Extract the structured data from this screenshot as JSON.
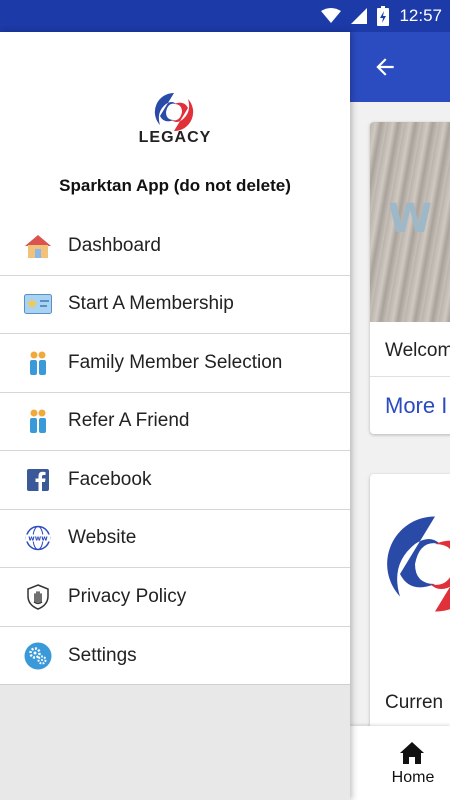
{
  "status_bar": {
    "time": "12:57",
    "bg_color": "#1c3aa8"
  },
  "app_bar": {
    "back_icon": "arrow-left-icon",
    "bg_color": "#2b4bc1"
  },
  "background_cards": [
    {
      "title": "Welcom",
      "link": "More I",
      "image_text": "W"
    },
    {
      "title": "Curren"
    }
  ],
  "bottom_nav": {
    "home_label": "Home",
    "home_icon": "home-icon"
  },
  "drawer": {
    "brand": "LEGACY",
    "app_name": "Sparktan App (do not delete)",
    "items": [
      {
        "label": "Dashboard",
        "icon": "house-icon"
      },
      {
        "label": "Start A Membership",
        "icon": "membership-card-icon"
      },
      {
        "label": "Family Member Selection",
        "icon": "people-icon"
      },
      {
        "label": "Refer A Friend",
        "icon": "people-icon"
      },
      {
        "label": "Facebook",
        "icon": "facebook-icon"
      },
      {
        "label": "Website",
        "icon": "www-globe-icon"
      },
      {
        "label": "Privacy Policy",
        "icon": "shield-hand-icon"
      },
      {
        "label": "Settings",
        "icon": "gears-icon"
      }
    ]
  },
  "colors": {
    "primary": "#2b4bc1",
    "logo_red": "#e0303a",
    "logo_blue": "#2a4aa8"
  }
}
